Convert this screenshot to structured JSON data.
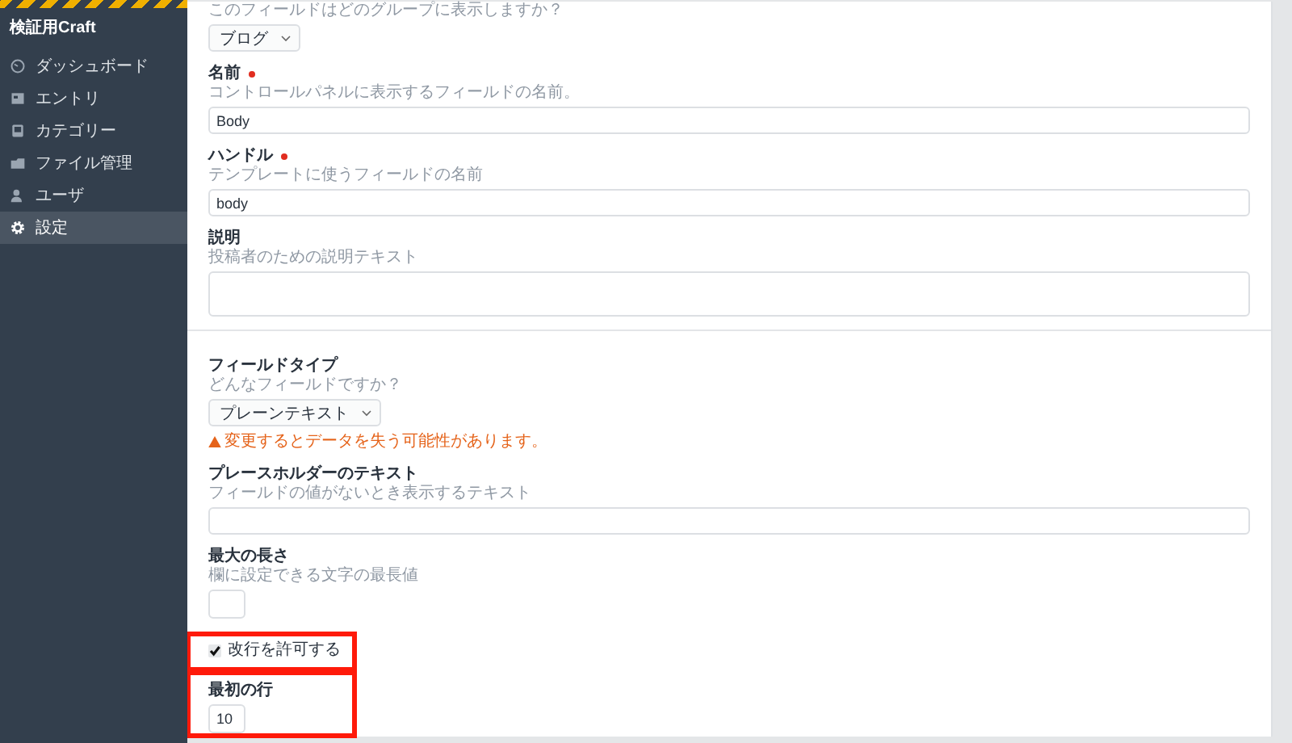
{
  "sidebar": {
    "site_name": "検証用Craft",
    "items": [
      {
        "label": "ダッシュボード",
        "selected": false
      },
      {
        "label": "エントリ",
        "selected": false
      },
      {
        "label": "カテゴリー",
        "selected": false
      },
      {
        "label": "ファイル管理",
        "selected": false
      },
      {
        "label": "ユーザ",
        "selected": false
      },
      {
        "label": "設定",
        "selected": true
      }
    ]
  },
  "sections": [
    {
      "fields": [
        {
          "kind": "select",
          "hint": "このフィールドはどのグループに表示しますか？",
          "value": "ブログ",
          "highlighted": false
        },
        {
          "kind": "text",
          "label": "名前",
          "required": true,
          "hint": "コントロールパネルに表示するフィールドの名前。",
          "value": "Body",
          "highlighted": false
        },
        {
          "kind": "text",
          "label": "ハンドル",
          "required": true,
          "hint": "テンプレートに使うフィールドの名前",
          "value": "body",
          "highlighted": false
        },
        {
          "kind": "textarea",
          "label": "説明",
          "required": false,
          "hint": "投稿者のための説明テキスト",
          "highlighted": false
        }
      ]
    },
    {
      "fields": [
        {
          "kind": "select",
          "label": "フィールドタイプ",
          "hint": "どんなフィールドですか？",
          "value": "プレーンテキスト",
          "warning": "変更するとデータを失う可能性があります。",
          "highlighted": false
        },
        {
          "kind": "text",
          "label": "プレースホルダーのテキスト",
          "required": false,
          "hint": "フィールドの値がないとき表示するテキスト",
          "highlighted": false
        },
        {
          "kind": "short",
          "label": "最大の長さ",
          "hint": "欄に設定できる文字の最長値",
          "highlighted": false
        },
        {
          "kind": "checkbox",
          "label": "改行を許可する",
          "checked": true,
          "highlighted": true
        },
        {
          "kind": "short",
          "label": "最初の行",
          "value": "10",
          "highlighted": true
        }
      ]
    }
  ]
}
